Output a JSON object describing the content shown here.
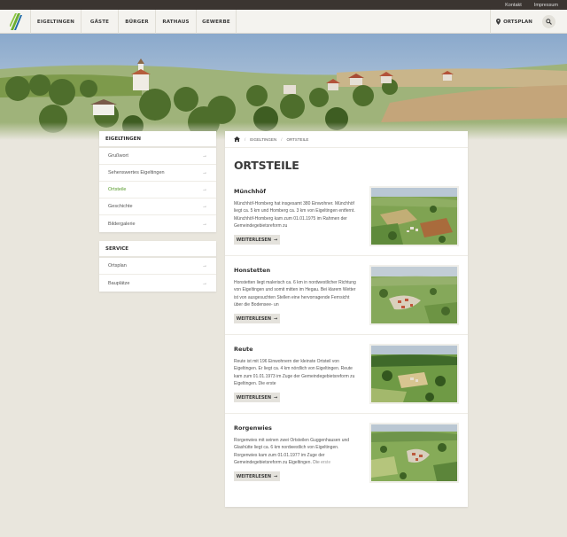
{
  "topbar": {
    "links": [
      "Kontakt",
      "Impressum"
    ]
  },
  "nav": {
    "items": [
      "EIGELTINGEN",
      "GÄSTE",
      "BÜRGER",
      "RATHAUS",
      "GEWERBE"
    ],
    "ortsplan": "ORTSPLAN"
  },
  "colors": {
    "accent": "#5a9c2e",
    "topbar": "#3b3531",
    "background": "#e9e6dd"
  },
  "sidebar": {
    "box1": {
      "title": "EIGELTINGEN",
      "items": [
        "Grußwort",
        "Sehenswertes Eigeltingen",
        "Ortsteile",
        "Geschichte",
        "Bildergalerie"
      ],
      "active_index": 2
    },
    "box2": {
      "title": "SERVICE",
      "items": [
        "Ortsplan",
        "Bauplätze"
      ]
    }
  },
  "breadcrumb": [
    "EIGELTINGEN",
    "ORTSTEILE"
  ],
  "page_title": "ORTSTEILE",
  "entries": [
    {
      "title": "Münchhöf",
      "text": "Münchhöf-Homberg hat insgesamt 380 Einwohner. Münchhöf liegt ca. 5 km und Homberg ca. 3 km von Eigeltingen entfernt. Münchhöf-Homberg kam zum 01.01.1975 im Rahmen der Gemeindegebietsreform zu",
      "button": "WEITERLESEN"
    },
    {
      "title": "Honstetten",
      "text": "Honstetten liegt malerisch ca. 6 km in nordwestlicher Richtung von Eigeltingen und somit mitten im Hegau. Bei klarem Wetter ist von ausgesuchten Stellen eine hervorragende Fernsicht über die Bodensee- un",
      "button": "WEITERLESEN"
    },
    {
      "title": "Reute",
      "text": "Reute ist mit 196 Einwohnern der kleinste Ortsteil von Eigeltingen. Er liegt ca. 4 km nördlich von Eigeltingen. Reute kam zum 01.01.1973 im Zuge der Gemeindegebietsreform zu Eigeltingen. Die erste",
      "button": "WEITERLESEN"
    },
    {
      "title": "Rorgenwies",
      "text": "Rorgenwies mit seinen zwei Ortsteilen Guggenhausen und Glashütte liegt ca. 6 km nordwestlich von Eigeltingen. Rorgenwies kam zum 01.01.1977 im Zuge der Gemeindegebietsreform zu Eigeltingen. Die erste",
      "button": "WEITERLESEN"
    }
  ]
}
